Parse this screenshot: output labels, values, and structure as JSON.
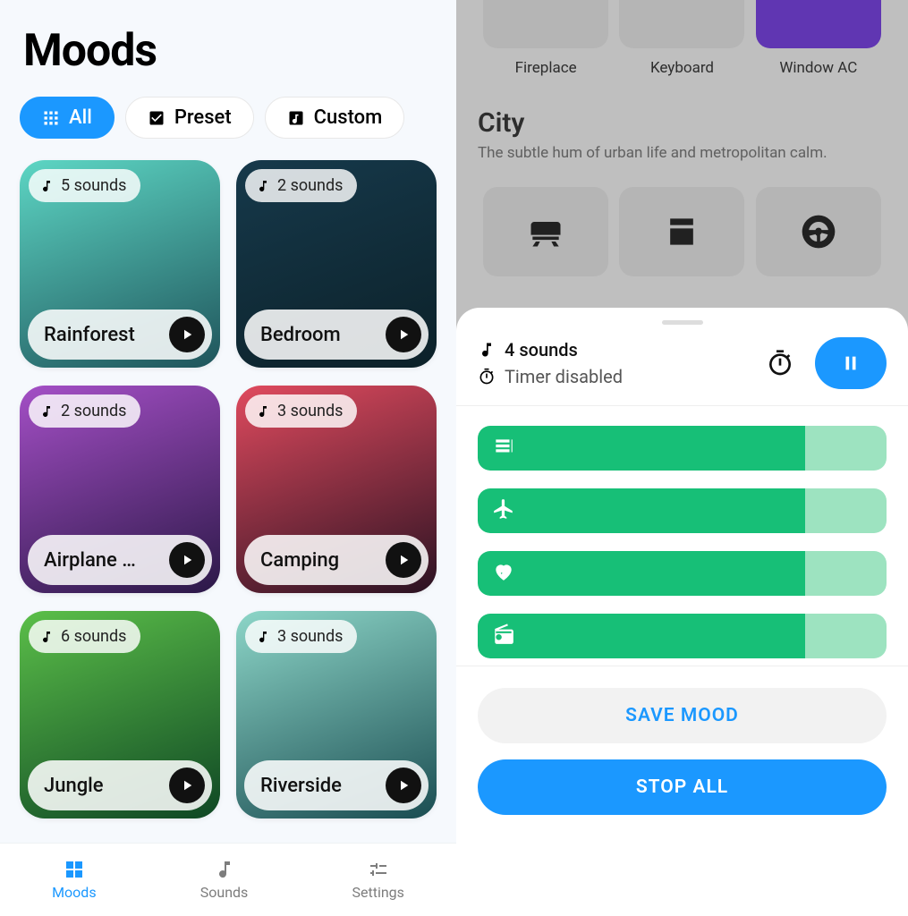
{
  "left": {
    "title": "Moods",
    "filters": [
      {
        "label": "All",
        "icon": "grid-icon",
        "active": true
      },
      {
        "label": "Preset",
        "icon": "check-box-icon",
        "active": false
      },
      {
        "label": "Custom",
        "icon": "note-box-icon",
        "active": false
      }
    ],
    "moods": [
      {
        "name": "Rainforest",
        "sounds": "5 sounds",
        "bg_from": "#5dd6c4",
        "bg_to": "#1f545b"
      },
      {
        "name": "Bedroom",
        "sounds": "2 sounds",
        "bg_from": "#16394b",
        "bg_to": "#0c2129"
      },
      {
        "name": "Airplane …",
        "sounds": "2 sounds",
        "bg_from": "#a44fc6",
        "bg_to": "#2b1847"
      },
      {
        "name": "Camping",
        "sounds": "3 sounds",
        "bg_from": "#e04a5e",
        "bg_to": "#2a1222"
      },
      {
        "name": "Jungle",
        "sounds": "6 sounds",
        "bg_from": "#5bbf49",
        "bg_to": "#0f4724"
      },
      {
        "name": "Riverside",
        "sounds": "3 sounds",
        "bg_from": "#8dd6c8",
        "bg_to": "#1b4d52"
      }
    ],
    "nav": [
      {
        "label": "Moods",
        "icon": "grid-large-icon",
        "active": true
      },
      {
        "label": "Sounds",
        "icon": "note-icon",
        "active": false
      },
      {
        "label": "Settings",
        "icon": "sliders-icon",
        "active": false
      }
    ]
  },
  "right": {
    "store_top": [
      {
        "label": "Fireplace"
      },
      {
        "label": "Keyboard"
      },
      {
        "label": "Window AC",
        "highlight": true
      }
    ],
    "section_title": "City",
    "section_sub": "The subtle hum of urban life and metropolitan calm.",
    "icon_row": [
      "train-icon",
      "oven-icon",
      "wheel-icon"
    ],
    "sheet": {
      "sounds_count": "4 sounds",
      "timer_status": "Timer disabled",
      "sliders": [
        {
          "icon": "stack-icon",
          "percent": 80
        },
        {
          "icon": "plane-icon",
          "percent": 80
        },
        {
          "icon": "heart-icon",
          "percent": 80
        },
        {
          "icon": "radio-icon",
          "percent": 80
        }
      ],
      "save_label": "SAVE MOOD",
      "stop_label": "STOP ALL"
    }
  }
}
